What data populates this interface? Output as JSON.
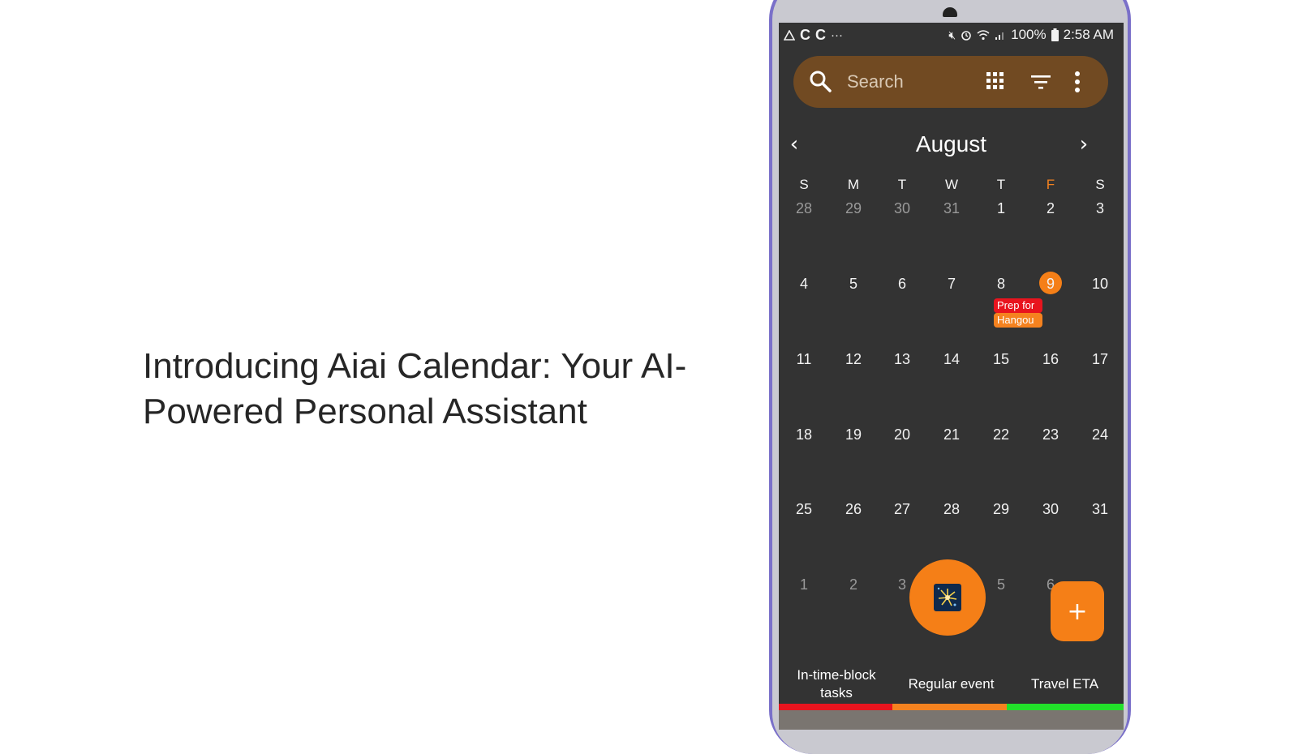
{
  "headline": "Introducing Aiai Calendar: Your AI-Powered Personal Assistant",
  "status_bar": {
    "left_icons": [
      "drive-icon",
      "c-icon",
      "c-icon",
      "more-icon"
    ],
    "left_text": [
      "C",
      "C",
      "···"
    ],
    "battery": "100%",
    "time": "2:58 AM"
  },
  "search": {
    "placeholder": "Search"
  },
  "calendar": {
    "month": "August",
    "weekdays": [
      "S",
      "M",
      "T",
      "W",
      "T",
      "F",
      "S"
    ],
    "highlight_weekday_index": 5,
    "weeks": [
      [
        "28",
        "29",
        "30",
        "31",
        "1",
        "2",
        "3"
      ],
      [
        "4",
        "5",
        "6",
        "7",
        "8",
        "9",
        "10"
      ],
      [
        "11",
        "12",
        "13",
        "14",
        "15",
        "16",
        "17"
      ],
      [
        "18",
        "19",
        "20",
        "21",
        "22",
        "23",
        "24"
      ],
      [
        "25",
        "26",
        "27",
        "28",
        "29",
        "30",
        "31"
      ],
      [
        "1",
        "2",
        "3",
        "",
        "5",
        "6",
        ""
      ]
    ],
    "today": "9",
    "event": {
      "line1": "Prep for",
      "line2": "Hangou"
    }
  },
  "fab_add_label": "+",
  "legend": [
    {
      "label": "In-time-block tasks",
      "color": "#e8141e"
    },
    {
      "label": "Regular event",
      "color": "#f5821f"
    },
    {
      "label": "Travel ETA",
      "color": "#22e02a"
    }
  ],
  "colors": {
    "accent": "#f57f17",
    "search_bg": "#714a22",
    "screen_bg": "#333333",
    "event_red": "#e8141e",
    "event_orange": "#f5821f"
  }
}
